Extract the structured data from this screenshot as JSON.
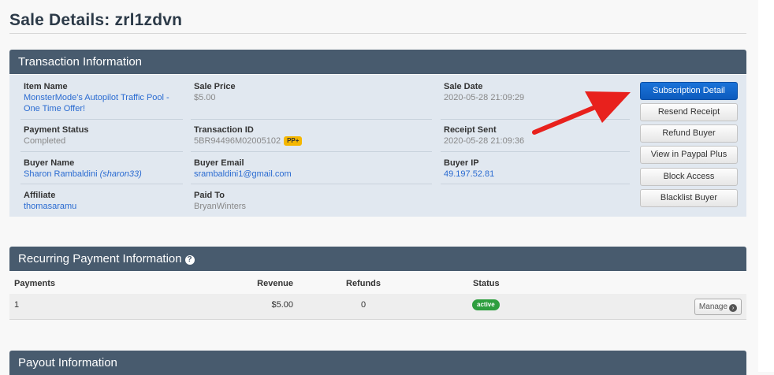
{
  "page": {
    "title": "Sale Details: zrl1zdvn"
  },
  "transaction": {
    "header": "Transaction Information",
    "item_name": {
      "label": "Item Name",
      "value": "MonsterMode's Autopilot Traffic Pool - One Time Offer!"
    },
    "sale_price": {
      "label": "Sale Price",
      "value": "$5.00"
    },
    "sale_date": {
      "label": "Sale Date",
      "value": "2020-05-28 21:09:29"
    },
    "payment_status": {
      "label": "Payment Status",
      "value": "Completed"
    },
    "transaction_id": {
      "label": "Transaction ID",
      "value": "5BR94496M02005102",
      "badge": "PP+"
    },
    "receipt_sent": {
      "label": "Receipt Sent",
      "value": "2020-05-28 21:09:36"
    },
    "buyer_name": {
      "label": "Buyer Name",
      "value": "Sharon Rambaldini",
      "username": "(sharon33)"
    },
    "buyer_email": {
      "label": "Buyer Email",
      "value": "srambaldini1@gmail.com"
    },
    "buyer_ip": {
      "label": "Buyer IP",
      "value": "49.197.52.81"
    },
    "affiliate": {
      "label": "Affiliate",
      "value": "thomasaramu"
    },
    "paid_to": {
      "label": "Paid To",
      "value": "BryanWinters"
    }
  },
  "actions": {
    "subscription_detail": "Subscription Detail",
    "resend_receipt": "Resend Receipt",
    "refund_buyer": "Refund Buyer",
    "view_paypal_plus": "View in Paypal Plus",
    "block_access": "Block Access",
    "blacklist_buyer": "Blacklist Buyer"
  },
  "recurring": {
    "header": "Recurring Payment Information",
    "help_icon": "?",
    "columns": {
      "payments": "Payments",
      "revenue": "Revenue",
      "refunds": "Refunds",
      "status": "Status"
    },
    "rows": [
      {
        "payments": "1",
        "revenue": "$5.00",
        "refunds": "0",
        "status": "active",
        "action": "Manage"
      }
    ]
  },
  "payout": {
    "header": "Payout Information"
  },
  "colors": {
    "panel_header": "#485b6e",
    "panel_body": "#e1e8f0",
    "primary_button": "#0d5bbd",
    "status_active": "#2e9e3e",
    "badge_pp": "#f5b700",
    "annotation_arrow": "#e8211d",
    "link": "#2a6bd1"
  },
  "icons": {
    "help": "question-circle-icon",
    "manage": "chevron-right-circle-icon",
    "annotation": "red-arrow-annotation"
  }
}
